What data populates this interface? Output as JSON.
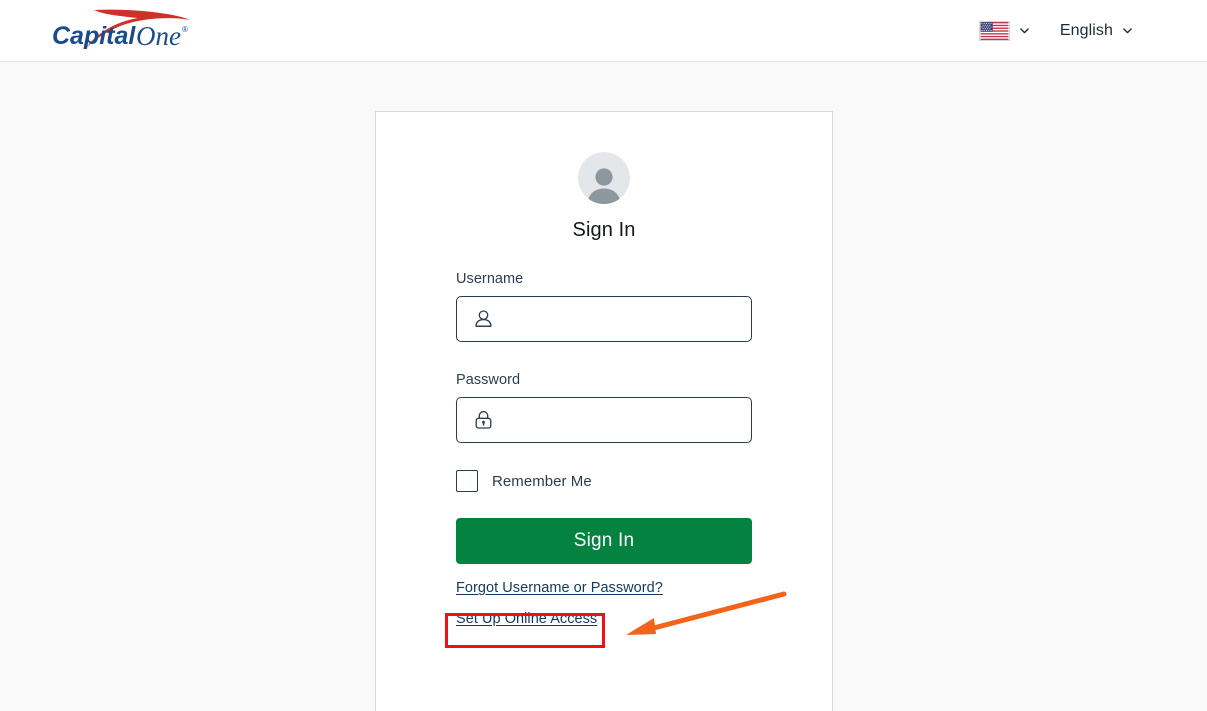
{
  "header": {
    "logo": {
      "name": "capital-one-logo",
      "text_primary": "Capital",
      "text_secondary": "One",
      "trademark": "®",
      "blue": "#1a4b8c",
      "red": "#d03027"
    },
    "locale": {
      "flag_icon": "us-flag-icon",
      "flag_alt": "United States",
      "chevron_icon": "chevron-down-icon"
    },
    "language": {
      "label": "English",
      "chevron_icon": "chevron-down-icon"
    }
  },
  "card": {
    "avatar_icon": "user-avatar-icon",
    "title": "Sign In",
    "username": {
      "label": "Username",
      "icon": "person-outline-icon",
      "value": "",
      "placeholder": ""
    },
    "password": {
      "label": "Password",
      "icon": "lock-outline-icon",
      "value": "",
      "placeholder": ""
    },
    "remember": {
      "label": "Remember Me",
      "checked": false
    },
    "submit": {
      "label": "Sign In",
      "color": "#03833f"
    },
    "links": [
      {
        "label": "Forgot Username or Password?"
      },
      {
        "label": "Set Up Online Access"
      }
    ]
  },
  "annotation": {
    "box_color": "#ee1111",
    "arrow_color": "#f26419",
    "target": "Set Up Online Access"
  }
}
